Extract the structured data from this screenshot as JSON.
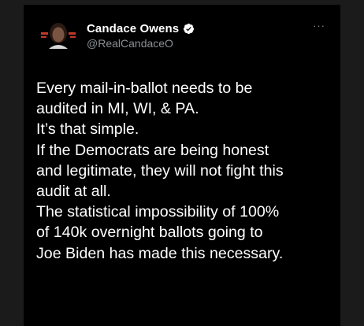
{
  "tweet": {
    "author": {
      "display_name": "Candace Owens",
      "handle": "@RealCandaceO",
      "verified_icon": "verified-badge-icon",
      "avatar_icon": "profile-avatar"
    },
    "more_icon": "more-options-icon",
    "more_label": "···",
    "lines": [
      "Every mail-in-ballot needs to be",
      "audited in MI, WI, & PA.",
      "It’s that simple.",
      "If the Democrats are being honest",
      "and legitimate, they will not fight this",
      "audit at all.",
      "The statistical impossibility of 100%",
      "of 140k overnight ballots going to",
      "Joe Biden has made this necessary."
    ]
  },
  "colors": {
    "card_background": "#000000",
    "page_background": "#1b1b1b",
    "text_primary": "#ffffff",
    "text_secondary": "#8b8f93",
    "verified_badge": "#ffffff"
  }
}
